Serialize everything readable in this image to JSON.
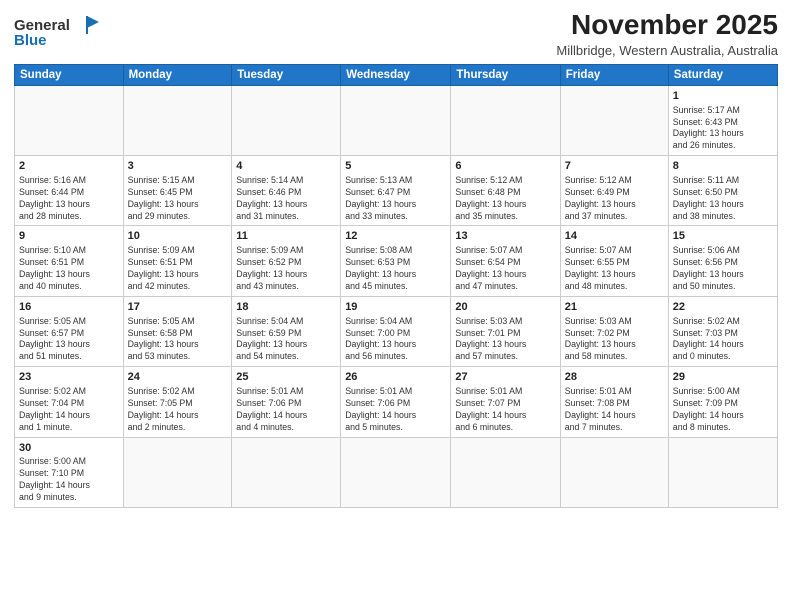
{
  "header": {
    "logo_line1": "General",
    "logo_line2": "Blue",
    "month_title": "November 2025",
    "subtitle": "Millbridge, Western Australia, Australia"
  },
  "weekdays": [
    "Sunday",
    "Monday",
    "Tuesday",
    "Wednesday",
    "Thursday",
    "Friday",
    "Saturday"
  ],
  "weeks": [
    [
      {
        "day": "",
        "info": ""
      },
      {
        "day": "",
        "info": ""
      },
      {
        "day": "",
        "info": ""
      },
      {
        "day": "",
        "info": ""
      },
      {
        "day": "",
        "info": ""
      },
      {
        "day": "",
        "info": ""
      },
      {
        "day": "1",
        "info": "Sunrise: 5:17 AM\nSunset: 6:43 PM\nDaylight: 13 hours\nand 26 minutes."
      }
    ],
    [
      {
        "day": "2",
        "info": "Sunrise: 5:16 AM\nSunset: 6:44 PM\nDaylight: 13 hours\nand 28 minutes."
      },
      {
        "day": "3",
        "info": "Sunrise: 5:15 AM\nSunset: 6:45 PM\nDaylight: 13 hours\nand 29 minutes."
      },
      {
        "day": "4",
        "info": "Sunrise: 5:14 AM\nSunset: 6:46 PM\nDaylight: 13 hours\nand 31 minutes."
      },
      {
        "day": "5",
        "info": "Sunrise: 5:13 AM\nSunset: 6:47 PM\nDaylight: 13 hours\nand 33 minutes."
      },
      {
        "day": "6",
        "info": "Sunrise: 5:12 AM\nSunset: 6:48 PM\nDaylight: 13 hours\nand 35 minutes."
      },
      {
        "day": "7",
        "info": "Sunrise: 5:12 AM\nSunset: 6:49 PM\nDaylight: 13 hours\nand 37 minutes."
      },
      {
        "day": "8",
        "info": "Sunrise: 5:11 AM\nSunset: 6:50 PM\nDaylight: 13 hours\nand 38 minutes."
      }
    ],
    [
      {
        "day": "9",
        "info": "Sunrise: 5:10 AM\nSunset: 6:51 PM\nDaylight: 13 hours\nand 40 minutes."
      },
      {
        "day": "10",
        "info": "Sunrise: 5:09 AM\nSunset: 6:51 PM\nDaylight: 13 hours\nand 42 minutes."
      },
      {
        "day": "11",
        "info": "Sunrise: 5:09 AM\nSunset: 6:52 PM\nDaylight: 13 hours\nand 43 minutes."
      },
      {
        "day": "12",
        "info": "Sunrise: 5:08 AM\nSunset: 6:53 PM\nDaylight: 13 hours\nand 45 minutes."
      },
      {
        "day": "13",
        "info": "Sunrise: 5:07 AM\nSunset: 6:54 PM\nDaylight: 13 hours\nand 47 minutes."
      },
      {
        "day": "14",
        "info": "Sunrise: 5:07 AM\nSunset: 6:55 PM\nDaylight: 13 hours\nand 48 minutes."
      },
      {
        "day": "15",
        "info": "Sunrise: 5:06 AM\nSunset: 6:56 PM\nDaylight: 13 hours\nand 50 minutes."
      }
    ],
    [
      {
        "day": "16",
        "info": "Sunrise: 5:05 AM\nSunset: 6:57 PM\nDaylight: 13 hours\nand 51 minutes."
      },
      {
        "day": "17",
        "info": "Sunrise: 5:05 AM\nSunset: 6:58 PM\nDaylight: 13 hours\nand 53 minutes."
      },
      {
        "day": "18",
        "info": "Sunrise: 5:04 AM\nSunset: 6:59 PM\nDaylight: 13 hours\nand 54 minutes."
      },
      {
        "day": "19",
        "info": "Sunrise: 5:04 AM\nSunset: 7:00 PM\nDaylight: 13 hours\nand 56 minutes."
      },
      {
        "day": "20",
        "info": "Sunrise: 5:03 AM\nSunset: 7:01 PM\nDaylight: 13 hours\nand 57 minutes."
      },
      {
        "day": "21",
        "info": "Sunrise: 5:03 AM\nSunset: 7:02 PM\nDaylight: 13 hours\nand 58 minutes."
      },
      {
        "day": "22",
        "info": "Sunrise: 5:02 AM\nSunset: 7:03 PM\nDaylight: 14 hours\nand 0 minutes."
      }
    ],
    [
      {
        "day": "23",
        "info": "Sunrise: 5:02 AM\nSunset: 7:04 PM\nDaylight: 14 hours\nand 1 minute."
      },
      {
        "day": "24",
        "info": "Sunrise: 5:02 AM\nSunset: 7:05 PM\nDaylight: 14 hours\nand 2 minutes."
      },
      {
        "day": "25",
        "info": "Sunrise: 5:01 AM\nSunset: 7:06 PM\nDaylight: 14 hours\nand 4 minutes."
      },
      {
        "day": "26",
        "info": "Sunrise: 5:01 AM\nSunset: 7:06 PM\nDaylight: 14 hours\nand 5 minutes."
      },
      {
        "day": "27",
        "info": "Sunrise: 5:01 AM\nSunset: 7:07 PM\nDaylight: 14 hours\nand 6 minutes."
      },
      {
        "day": "28",
        "info": "Sunrise: 5:01 AM\nSunset: 7:08 PM\nDaylight: 14 hours\nand 7 minutes."
      },
      {
        "day": "29",
        "info": "Sunrise: 5:00 AM\nSunset: 7:09 PM\nDaylight: 14 hours\nand 8 minutes."
      }
    ],
    [
      {
        "day": "30",
        "info": "Sunrise: 5:00 AM\nSunset: 7:10 PM\nDaylight: 14 hours\nand 9 minutes."
      },
      {
        "day": "",
        "info": ""
      },
      {
        "day": "",
        "info": ""
      },
      {
        "day": "",
        "info": ""
      },
      {
        "day": "",
        "info": ""
      },
      {
        "day": "",
        "info": ""
      },
      {
        "day": "",
        "info": ""
      }
    ]
  ]
}
